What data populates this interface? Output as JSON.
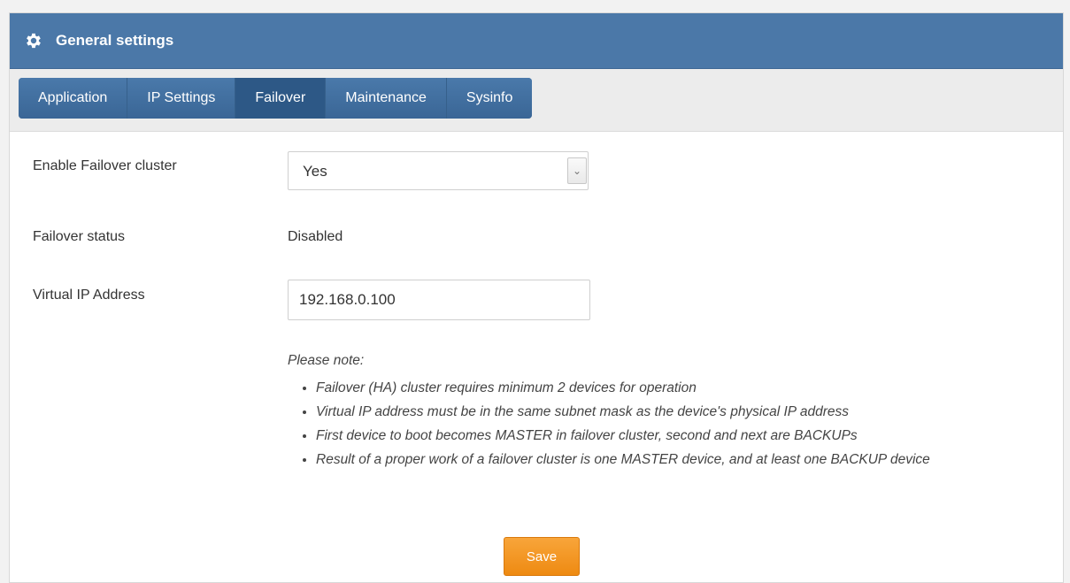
{
  "header": {
    "title": "General settings",
    "icon": "gear-icon"
  },
  "tabs": [
    {
      "label": "Application"
    },
    {
      "label": "IP Settings"
    },
    {
      "label": "Failover"
    },
    {
      "label": "Maintenance"
    },
    {
      "label": "Sysinfo"
    }
  ],
  "active_tab": "Failover",
  "form": {
    "enable_label": "Enable Failover cluster",
    "enable_value": "Yes",
    "status_label": "Failover status",
    "status_value": "Disabled",
    "vip_label": "Virtual IP Address",
    "vip_value": "192.168.0.100"
  },
  "note": {
    "title": "Please note:",
    "items": [
      "Failover (HA) cluster requires minimum 2 devices for operation",
      "Virtual IP address must be in the same subnet mask as the device's physical IP address",
      "First device to boot becomes MASTER in failover cluster, second and next are BACKUPs",
      "Result of a proper work of a failover cluster is one MASTER device, and at least one BACKUP device"
    ]
  },
  "save_label": "Save",
  "colors": {
    "header": "#4b78a8",
    "tab_active": "#2d5886",
    "save": "#f39b26"
  }
}
